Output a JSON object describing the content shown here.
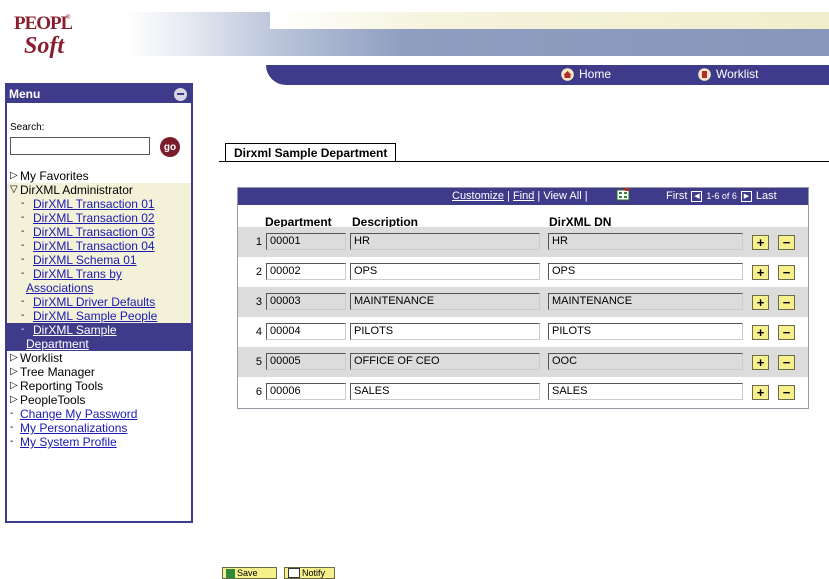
{
  "header": {
    "logo_text": "PEOPLE Soft",
    "nav": [
      {
        "label": "Home",
        "icon": "home-icon"
      },
      {
        "label": "Worklist",
        "icon": "worklist-icon"
      }
    ]
  },
  "menu": {
    "title": "Menu",
    "search_label": "Search:",
    "search_value": "",
    "go_label": "go",
    "items": [
      {
        "label": "My Favorites",
        "kind": "folder"
      },
      {
        "label": "DirXML Administrator",
        "kind": "folder-open"
      },
      {
        "label": "DirXML Transaction 01",
        "kind": "link"
      },
      {
        "label": "DirXML Transaction 02",
        "kind": "link"
      },
      {
        "label": "DirXML Transaction 03",
        "kind": "link"
      },
      {
        "label": "DirXML Transaction 04",
        "kind": "link"
      },
      {
        "label": "DirXML Schema 01",
        "kind": "link"
      },
      {
        "label": "DirXML Trans by",
        "kind": "link"
      },
      {
        "label": "Associations",
        "kind": "link-cont"
      },
      {
        "label": "DirXML Driver Defaults",
        "kind": "link"
      },
      {
        "label": "DirXML Sample People",
        "kind": "link"
      },
      {
        "label": "DirXML Sample",
        "kind": "link"
      },
      {
        "label": "Department",
        "kind": "link-cont"
      },
      {
        "label": "Worklist",
        "kind": "folder"
      },
      {
        "label": "Tree Manager",
        "kind": "folder"
      },
      {
        "label": "Reporting Tools",
        "kind": "folder"
      },
      {
        "label": "PeopleTools",
        "kind": "folder"
      },
      {
        "label": "Change My Password",
        "kind": "link"
      },
      {
        "label": "My Personalizations",
        "kind": "link"
      },
      {
        "label": "My System Profile",
        "kind": "link"
      }
    ]
  },
  "page": {
    "tab_label": "Dirxml Sample Department"
  },
  "grid": {
    "customize": "Customize",
    "sep": "|",
    "find": "Find",
    "view_all": "View All",
    "first": "First",
    "count": "1-6 of 6",
    "last": "Last",
    "columns": [
      "Department",
      "Description",
      "DirXML DN"
    ],
    "rows": [
      {
        "num": "1",
        "dept": "00001",
        "desc": "HR",
        "dn": "HR"
      },
      {
        "num": "2",
        "dept": "00002",
        "desc": "OPS",
        "dn": "OPS"
      },
      {
        "num": "3",
        "dept": "00003",
        "desc": "MAINTENANCE",
        "dn": "MAINTENANCE"
      },
      {
        "num": "4",
        "dept": "00004",
        "desc": "PILOTS",
        "dn": "PILOTS"
      },
      {
        "num": "5",
        "dept": "00005",
        "desc": "OFFICE OF CEO",
        "dn": "OOC"
      },
      {
        "num": "6",
        "dept": "00006",
        "desc": "SALES",
        "dn": "SALES"
      }
    ],
    "add_label": "+",
    "delete_label": "−"
  },
  "footer": {
    "save_label": "Save",
    "notify_label": "Notify"
  },
  "colors": {
    "brand_navy": "#3f3b8b",
    "link_blue": "#1a1ab3",
    "button_yellow": "#f6f08c",
    "logo_maroon": "#8a1e2d"
  }
}
